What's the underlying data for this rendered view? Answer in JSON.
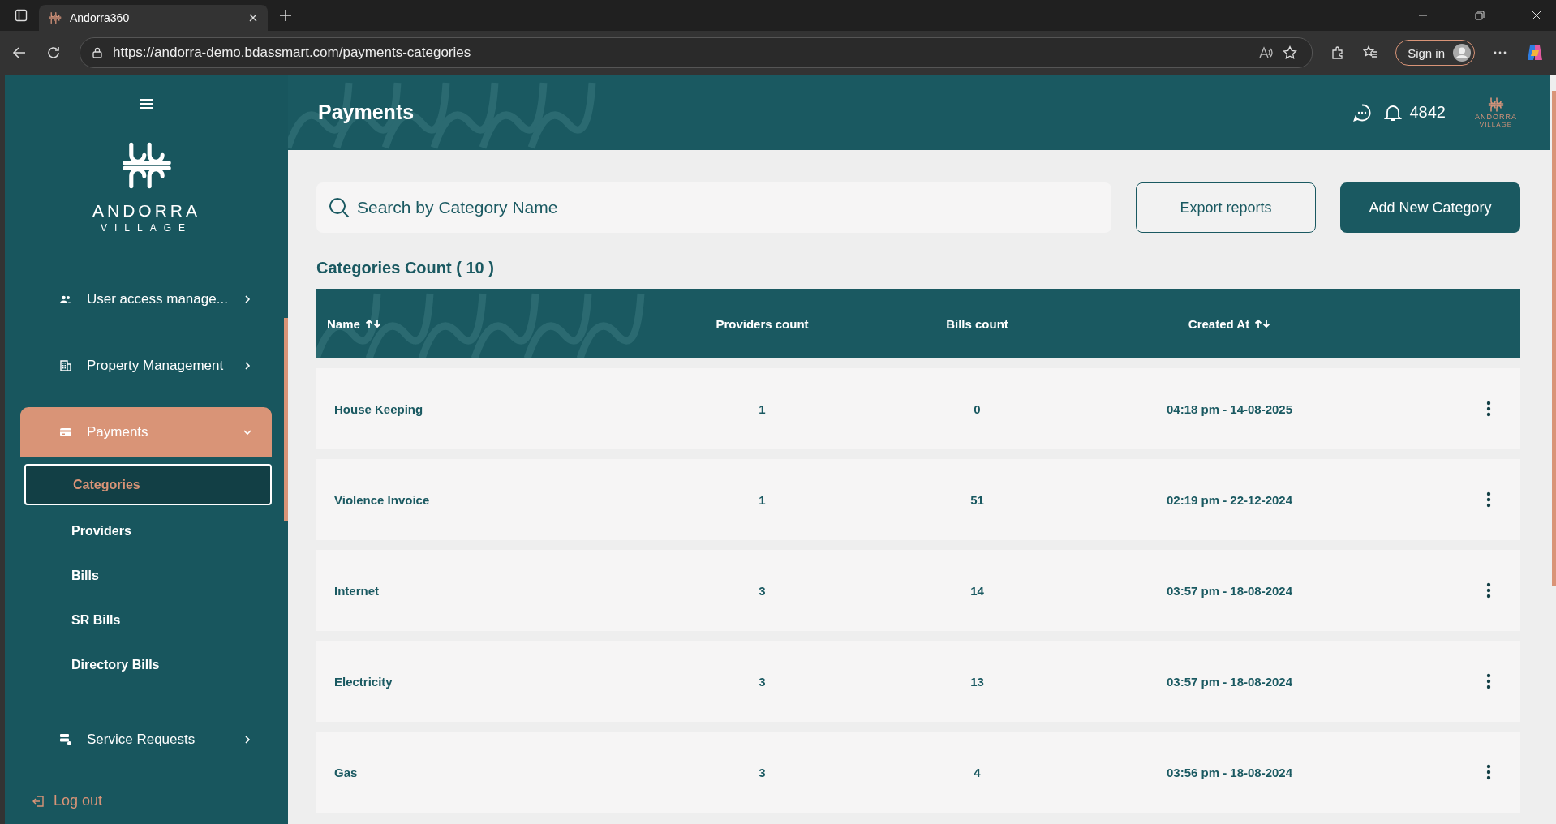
{
  "browser": {
    "tab_title": "Andorra360",
    "url": "https://andorra-demo.bdassmart.com/payments-categories",
    "sign_in": "Sign in"
  },
  "sidebar": {
    "logo_name": "ANDORRA",
    "logo_sub": "VILLAGE",
    "items": [
      {
        "label": "User access manage...",
        "expanded": false,
        "selected": false
      },
      {
        "label": "Property Management",
        "expanded": false,
        "selected": false
      },
      {
        "label": "Payments",
        "expanded": true,
        "selected": true,
        "children": [
          {
            "label": "Categories",
            "selected": true
          },
          {
            "label": "Providers",
            "selected": false
          },
          {
            "label": "Bills",
            "selected": false
          },
          {
            "label": "SR Bills",
            "selected": false
          },
          {
            "label": "Directory Bills",
            "selected": false
          }
        ]
      },
      {
        "label": "Service Requests",
        "expanded": false,
        "selected": false
      }
    ],
    "logout": "Log out"
  },
  "header": {
    "title": "Payments",
    "notifications": "4842",
    "logo_name": "ANDORRA",
    "logo_sub": "VILLAGE"
  },
  "search": {
    "placeholder": "Search by Category Name"
  },
  "buttons": [
    {
      "label": "Export reports",
      "kind": "outline"
    },
    {
      "label": "Add New Category",
      "kind": "primary"
    }
  ],
  "count_title": "Categories Count ( 10 )",
  "table": {
    "columns": [
      {
        "label": "Name",
        "sortable": true
      },
      {
        "label": "Providers count",
        "sortable": false
      },
      {
        "label": "Bills count",
        "sortable": false
      },
      {
        "label": "Created At",
        "sortable": true
      }
    ],
    "rows": [
      [
        "House Keeping",
        "1",
        "0",
        "04:18 pm - 14-08-2025"
      ],
      [
        "Violence Invoice",
        "1",
        "51",
        "02:19 pm - 22-12-2024"
      ],
      [
        "Internet",
        "3",
        "14",
        "03:57 pm - 18-08-2024"
      ],
      [
        "Electricity",
        "3",
        "13",
        "03:57 pm - 18-08-2024"
      ],
      [
        "Gas",
        "3",
        "4",
        "03:56 pm - 18-08-2024"
      ]
    ]
  }
}
